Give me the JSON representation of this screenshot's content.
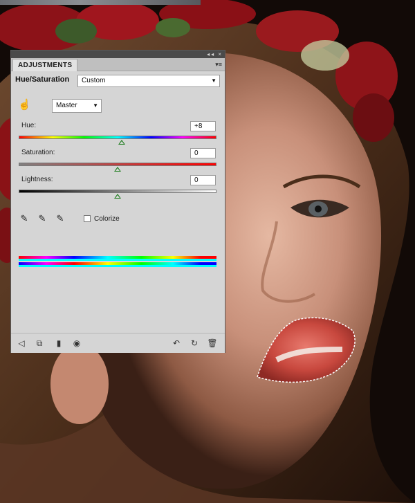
{
  "panel": {
    "tab_label": "ADJUSTMENTS",
    "strip_buttons": "◂◂ ×",
    "menu_icon": "panel-menu-icon",
    "adjustment_title": "Hue/Saturation",
    "preset": {
      "value": "Custom"
    },
    "channel": {
      "value": "Master"
    },
    "hue": {
      "label": "Hue:",
      "value": "+8",
      "fraction": 0.522
    },
    "saturation": {
      "label": "Saturation:",
      "value": "0",
      "fraction": 0.5
    },
    "lightness": {
      "label": "Lightness:",
      "value": "0",
      "fraction": 0.5
    },
    "colorize": {
      "label": "Colorize",
      "checked": false
    },
    "tools": [
      "eyedropper-icon",
      "eyedropper-plus-icon",
      "eyedropper-minus-icon"
    ],
    "bottom_icons_left": [
      "back-arrow-icon",
      "clip-to-layer-icon",
      "visibility-toggle-icon",
      "eye-icon"
    ],
    "bottom_icons_right": [
      "view-previous-icon",
      "reset-icon",
      "trash-icon"
    ]
  },
  "colors": {
    "panel_bg": "#d5d5d5",
    "slider_thumb": "#1e7d1e",
    "title_strip": "#4a4a4a"
  }
}
